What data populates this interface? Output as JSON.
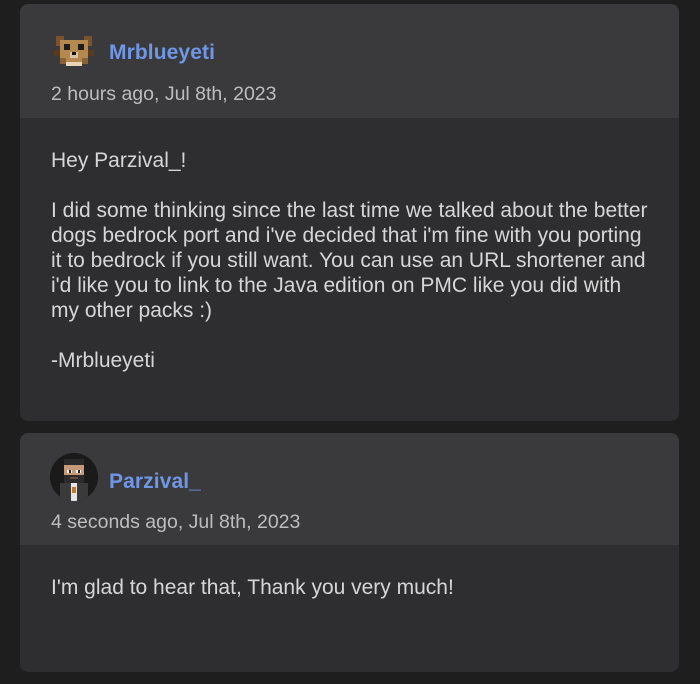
{
  "messages": [
    {
      "username": "Mrblueyeti",
      "timestamp": "2 hours ago, Jul 8th, 2023",
      "greeting": "Hey Parzival_!",
      "body": "I did some thinking since the last time we talked about the better dogs bedrock port and i've decided that i'm fine with you porting it to bedrock if you still want. You can use an URL shortener and i'd like you to link to the Java edition on PMC like you did with my other packs :)",
      "signature": "-Mrblueyeti",
      "avatar_icon": "pixel-dog-avatar-icon"
    },
    {
      "username": "Parzival_",
      "timestamp": "4 seconds ago, Jul 8th, 2023",
      "body": "I'm glad to hear that, Thank you very much!",
      "avatar_icon": "pixel-character-avatar-icon"
    }
  ],
  "colors": {
    "page_bg": "#1e1e1f",
    "card_bg": "#2e2e30",
    "header_bg": "#3a3a3c",
    "username": "#6f97e6",
    "text": "#d6d6d6",
    "muted": "#bdbdbd"
  }
}
